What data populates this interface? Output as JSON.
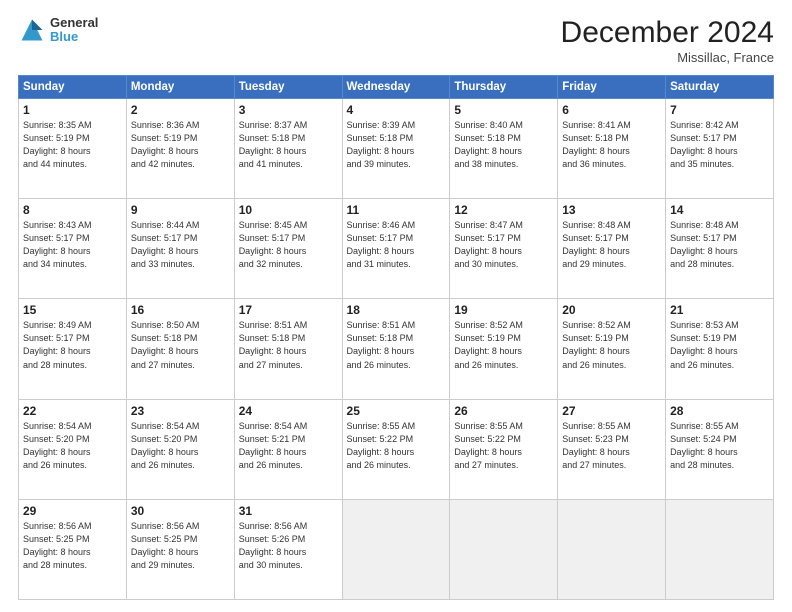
{
  "header": {
    "logo_line1": "General",
    "logo_line2": "Blue",
    "month_title": "December 2024",
    "location": "Missillac, France"
  },
  "days_of_week": [
    "Sunday",
    "Monday",
    "Tuesday",
    "Wednesday",
    "Thursday",
    "Friday",
    "Saturday"
  ],
  "weeks": [
    [
      {
        "day": "1",
        "info": "Sunrise: 8:35 AM\nSunset: 5:19 PM\nDaylight: 8 hours\nand 44 minutes."
      },
      {
        "day": "2",
        "info": "Sunrise: 8:36 AM\nSunset: 5:19 PM\nDaylight: 8 hours\nand 42 minutes."
      },
      {
        "day": "3",
        "info": "Sunrise: 8:37 AM\nSunset: 5:18 PM\nDaylight: 8 hours\nand 41 minutes."
      },
      {
        "day": "4",
        "info": "Sunrise: 8:39 AM\nSunset: 5:18 PM\nDaylight: 8 hours\nand 39 minutes."
      },
      {
        "day": "5",
        "info": "Sunrise: 8:40 AM\nSunset: 5:18 PM\nDaylight: 8 hours\nand 38 minutes."
      },
      {
        "day": "6",
        "info": "Sunrise: 8:41 AM\nSunset: 5:18 PM\nDaylight: 8 hours\nand 36 minutes."
      },
      {
        "day": "7",
        "info": "Sunrise: 8:42 AM\nSunset: 5:17 PM\nDaylight: 8 hours\nand 35 minutes."
      }
    ],
    [
      {
        "day": "8",
        "info": "Sunrise: 8:43 AM\nSunset: 5:17 PM\nDaylight: 8 hours\nand 34 minutes."
      },
      {
        "day": "9",
        "info": "Sunrise: 8:44 AM\nSunset: 5:17 PM\nDaylight: 8 hours\nand 33 minutes."
      },
      {
        "day": "10",
        "info": "Sunrise: 8:45 AM\nSunset: 5:17 PM\nDaylight: 8 hours\nand 32 minutes."
      },
      {
        "day": "11",
        "info": "Sunrise: 8:46 AM\nSunset: 5:17 PM\nDaylight: 8 hours\nand 31 minutes."
      },
      {
        "day": "12",
        "info": "Sunrise: 8:47 AM\nSunset: 5:17 PM\nDaylight: 8 hours\nand 30 minutes."
      },
      {
        "day": "13",
        "info": "Sunrise: 8:48 AM\nSunset: 5:17 PM\nDaylight: 8 hours\nand 29 minutes."
      },
      {
        "day": "14",
        "info": "Sunrise: 8:48 AM\nSunset: 5:17 PM\nDaylight: 8 hours\nand 28 minutes."
      }
    ],
    [
      {
        "day": "15",
        "info": "Sunrise: 8:49 AM\nSunset: 5:17 PM\nDaylight: 8 hours\nand 28 minutes."
      },
      {
        "day": "16",
        "info": "Sunrise: 8:50 AM\nSunset: 5:18 PM\nDaylight: 8 hours\nand 27 minutes."
      },
      {
        "day": "17",
        "info": "Sunrise: 8:51 AM\nSunset: 5:18 PM\nDaylight: 8 hours\nand 27 minutes."
      },
      {
        "day": "18",
        "info": "Sunrise: 8:51 AM\nSunset: 5:18 PM\nDaylight: 8 hours\nand 26 minutes."
      },
      {
        "day": "19",
        "info": "Sunrise: 8:52 AM\nSunset: 5:19 PM\nDaylight: 8 hours\nand 26 minutes."
      },
      {
        "day": "20",
        "info": "Sunrise: 8:52 AM\nSunset: 5:19 PM\nDaylight: 8 hours\nand 26 minutes."
      },
      {
        "day": "21",
        "info": "Sunrise: 8:53 AM\nSunset: 5:19 PM\nDaylight: 8 hours\nand 26 minutes."
      }
    ],
    [
      {
        "day": "22",
        "info": "Sunrise: 8:54 AM\nSunset: 5:20 PM\nDaylight: 8 hours\nand 26 minutes."
      },
      {
        "day": "23",
        "info": "Sunrise: 8:54 AM\nSunset: 5:20 PM\nDaylight: 8 hours\nand 26 minutes."
      },
      {
        "day": "24",
        "info": "Sunrise: 8:54 AM\nSunset: 5:21 PM\nDaylight: 8 hours\nand 26 minutes."
      },
      {
        "day": "25",
        "info": "Sunrise: 8:55 AM\nSunset: 5:22 PM\nDaylight: 8 hours\nand 26 minutes."
      },
      {
        "day": "26",
        "info": "Sunrise: 8:55 AM\nSunset: 5:22 PM\nDaylight: 8 hours\nand 27 minutes."
      },
      {
        "day": "27",
        "info": "Sunrise: 8:55 AM\nSunset: 5:23 PM\nDaylight: 8 hours\nand 27 minutes."
      },
      {
        "day": "28",
        "info": "Sunrise: 8:55 AM\nSunset: 5:24 PM\nDaylight: 8 hours\nand 28 minutes."
      }
    ],
    [
      {
        "day": "29",
        "info": "Sunrise: 8:56 AM\nSunset: 5:25 PM\nDaylight: 8 hours\nand 28 minutes."
      },
      {
        "day": "30",
        "info": "Sunrise: 8:56 AM\nSunset: 5:25 PM\nDaylight: 8 hours\nand 29 minutes."
      },
      {
        "day": "31",
        "info": "Sunrise: 8:56 AM\nSunset: 5:26 PM\nDaylight: 8 hours\nand 30 minutes."
      },
      {
        "day": "",
        "info": ""
      },
      {
        "day": "",
        "info": ""
      },
      {
        "day": "",
        "info": ""
      },
      {
        "day": "",
        "info": ""
      }
    ]
  ]
}
